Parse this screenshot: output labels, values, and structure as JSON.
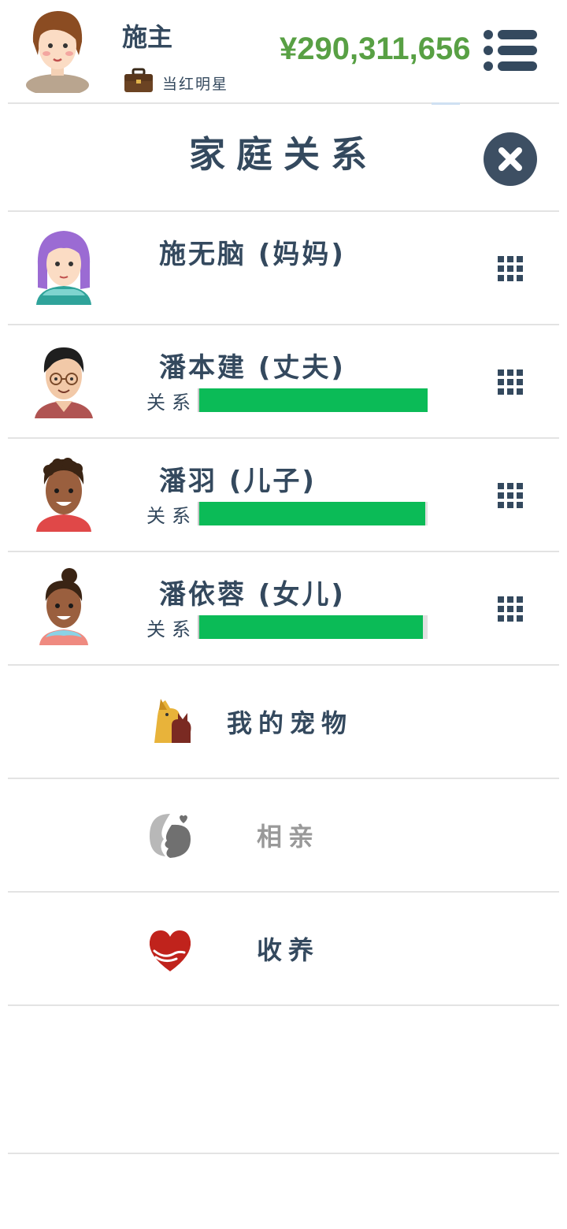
{
  "header": {
    "player_name": "施主",
    "job_title": "当红明星",
    "money": "¥290,311,656"
  },
  "page": {
    "title": "家庭关系"
  },
  "family": [
    {
      "name": "施无脑 (妈妈)",
      "relation_label": "",
      "relationship_level": null,
      "avatar": "purple-hair-woman-avatar"
    },
    {
      "name": "潘本建 (丈夫)",
      "relation_label": "关系",
      "relationship_level": 1.0,
      "avatar": "glasses-man-avatar"
    },
    {
      "name": "潘羽 (儿子)",
      "relation_label": "关系",
      "relationship_level": 0.99,
      "avatar": "curly-hair-boy-avatar"
    },
    {
      "name": "潘依蓉 (女儿)",
      "relation_label": "关系",
      "relationship_level": 0.98,
      "avatar": "bun-hair-girl-avatar"
    }
  ],
  "options": [
    {
      "label": "我的宠物",
      "icon": "pets-icon",
      "enabled": true
    },
    {
      "label": "相亲",
      "icon": "dating-icon",
      "enabled": false
    },
    {
      "label": "收养",
      "icon": "adoption-heart-icon",
      "enabled": true
    }
  ],
  "colors": {
    "money": "#58a044",
    "relationship_bar": "#0bbb57",
    "text": "#34495e",
    "disabled_text": "#999999"
  }
}
